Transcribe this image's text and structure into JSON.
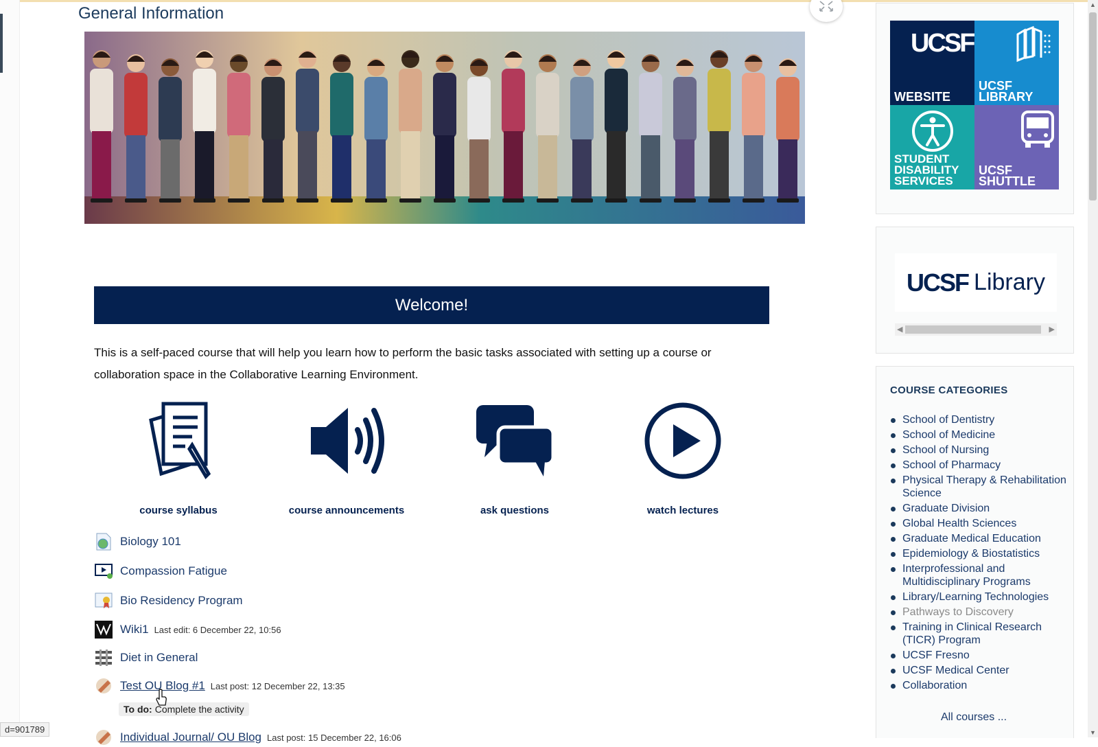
{
  "main": {
    "section_title": "General Information",
    "welcome": "Welcome!",
    "intro": "This is a self-paced course that will help you learn how to perform the basic tasks associated with setting up a course or collaboration space in the Collaborative Learning Environment.",
    "features": [
      {
        "label": "course syllabus",
        "icon": "document-pen-icon"
      },
      {
        "label": "course announcements",
        "icon": "speaker-icon"
      },
      {
        "label": "ask questions",
        "icon": "chat-bubbles-icon"
      },
      {
        "label": "watch lectures",
        "icon": "play-circle-icon"
      }
    ],
    "activities": [
      {
        "name": "Biology 101",
        "meta": "",
        "icon": "page-globe-icon"
      },
      {
        "name": "Compassion Fatigue",
        "meta": "",
        "icon": "video-icon"
      },
      {
        "name": "Bio Residency Program",
        "meta": "",
        "icon": "certificate-icon"
      },
      {
        "name": "Wiki1",
        "meta": "Last edit: 6 December 22, 10:56",
        "icon": "wiki-icon"
      },
      {
        "name": "Diet in General",
        "meta": "",
        "icon": "database-icon"
      },
      {
        "name": "Test OU Blog #1",
        "meta": "Last post: 12 December 22, 13:35",
        "icon": "blog-icon"
      },
      {
        "name": "Individual Journal/ OU Blog",
        "meta": "Last post: 15 December 22, 16:06",
        "icon": "blog-icon"
      }
    ],
    "todo": {
      "label": "To do:",
      "text": "Complete the activity"
    }
  },
  "status_chip": "d=901789",
  "sidebar": {
    "tiles": [
      {
        "name": "WEBSITE",
        "big": "UCSF",
        "color": "#052150"
      },
      {
        "name": "UCSF LIBRARY",
        "icon": "library-icon",
        "color": "#178ccf"
      },
      {
        "name": "STUDENT DISABILITY SERVICES",
        "icon": "accessibility-icon",
        "color": "#18a6a6"
      },
      {
        "name": "UCSF SHUTTLE",
        "icon": "bus-icon",
        "color": "#6c63b5"
      }
    ],
    "library_logo": {
      "ucsf": "UCSF",
      "library": "Library"
    },
    "categories": {
      "heading": "COURSE CATEGORIES",
      "items": [
        "School of Dentistry",
        "School of Medicine",
        "School of Nursing",
        "School of Pharmacy",
        "Physical Therapy & Rehabilitation Science",
        "Graduate Division",
        "Global Health Sciences",
        "Graduate Medical Education",
        "Epidemiology & Biostatistics",
        "Interprofessional and Multidisciplinary Programs",
        "Library/Learning Technologies",
        "Pathways to Discovery",
        "Training in Clinical Research (TICR) Program",
        "UCSF Fresno",
        "UCSF Medical Center",
        "Collaboration"
      ],
      "all_courses": "All courses ..."
    }
  },
  "colors": {
    "navy": "#052150",
    "link": "#1b3a6b",
    "accent_blue": "#178ccf",
    "teal": "#18a6a6",
    "purple": "#6c63b5"
  }
}
